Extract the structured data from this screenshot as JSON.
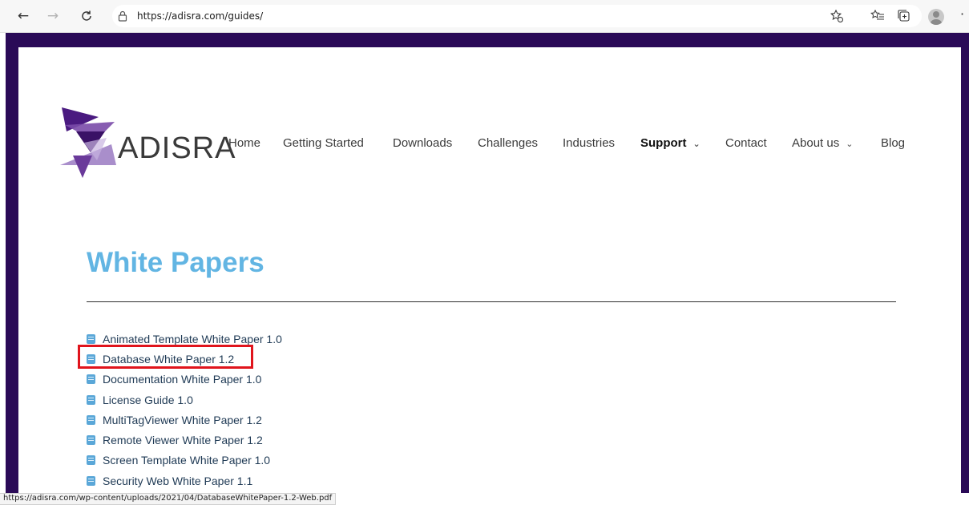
{
  "browser": {
    "back_icon": "←",
    "forward_icon": "→",
    "refresh_icon": "C",
    "url": "https://adisra.com/guides/",
    "lock_icon": "🔒",
    "favorites_add_icon": "☆",
    "favorites_icon": "≡",
    "collections_icon": "⊕",
    "more_icon": "·"
  },
  "site": {
    "logo_text": "ADISRA",
    "nav": [
      {
        "label": "Home"
      },
      {
        "label": "Getting Started"
      },
      {
        "label": "Downloads"
      },
      {
        "label": "Challenges"
      },
      {
        "label": "Industries"
      },
      {
        "label": "Support",
        "active": true,
        "dropdown": true
      },
      {
        "label": "Contact"
      },
      {
        "label": "About us",
        "dropdown": true
      },
      {
        "label": "Blog"
      }
    ],
    "chevron_icon": "⌄"
  },
  "content": {
    "title": "White Papers",
    "papers": [
      "Animated Template White Paper 1.0",
      "Database White Paper 1.2",
      "Documentation White Paper 1.0",
      "License Guide 1.0",
      "MultiTagViewer White Paper 1.2",
      "Remote Viewer White Paper 1.2",
      "Screen Template White Paper 1.0",
      "Security Web White Paper 1.1"
    ],
    "highlighted_index": 1
  },
  "status_bar": {
    "url": "https://adisra.com/wp-content/uploads/2021/04/DatabaseWhitePaper-1.2-Web.pdf"
  },
  "colors": {
    "frame": "#2a0a57",
    "title": "#62b5e3",
    "highlight": "#e0141c",
    "doc_icon": "#5aa7d8"
  }
}
